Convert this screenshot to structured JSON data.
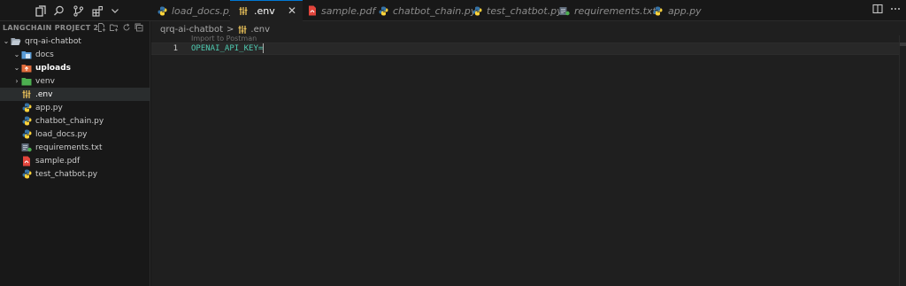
{
  "tabs": [
    {
      "label": "load_docs.py",
      "icon": "python-icon",
      "active": false
    },
    {
      "label": ".env",
      "icon": "env-icon",
      "active": true
    },
    {
      "label": "sample.pdf",
      "icon": "pdf-icon",
      "active": false
    },
    {
      "label": "chatbot_chain.py",
      "icon": "python-icon",
      "active": false
    },
    {
      "label": "test_chatbot.py",
      "icon": "python-icon",
      "active": false
    },
    {
      "label": "requirements.txt",
      "icon": "requirements-icon",
      "active": false
    },
    {
      "label": "app.py",
      "icon": "python-icon",
      "active": false
    }
  ],
  "tab_close_glyph": "✕",
  "explorer": {
    "title": "LANGCHAIN PROJECT 2",
    "items": [
      {
        "label": "qrq-ai-chatbot",
        "kind": "folder-open",
        "chevron": "⌄"
      },
      {
        "label": "docs",
        "kind": "folder-docs",
        "chevron": "⌄"
      },
      {
        "label": "uploads",
        "kind": "folder-uploads",
        "chevron": "⌄"
      },
      {
        "label": "venv",
        "kind": "folder-venv",
        "chevron": "›"
      },
      {
        "label": ".env",
        "kind": "env-file",
        "chevron": ""
      },
      {
        "label": "app.py",
        "kind": "python-file",
        "chevron": ""
      },
      {
        "label": "chatbot_chain.py",
        "kind": "python-file",
        "chevron": ""
      },
      {
        "label": "load_docs.py",
        "kind": "python-file",
        "chevron": ""
      },
      {
        "label": "requirements.txt",
        "kind": "requirements-file",
        "chevron": ""
      },
      {
        "label": "sample.pdf",
        "kind": "pdf-file",
        "chevron": ""
      },
      {
        "label": "test_chatbot.py",
        "kind": "python-file",
        "chevron": ""
      }
    ]
  },
  "breadcrumb": {
    "folder": "qrq-ai-chatbot",
    "separator": ">",
    "file": ".env"
  },
  "codelens": "Import to Postman",
  "editor": {
    "line_number": "1",
    "code": "OPENAI_API_KEY="
  },
  "colors": {
    "background": "#181818",
    "editor_bg": "#1f1f1f",
    "accent": "#0078d4",
    "code_text": "#4ec9b0",
    "python_blue": "#3572A5",
    "python_yellow": "#FFD43B",
    "env_yellow": "#e8c05a",
    "pdf_red": "#e2453c",
    "folder_blue": "#5a9bd5",
    "folder_green": "#4caf50",
    "folder_orange": "#e06c3c"
  }
}
